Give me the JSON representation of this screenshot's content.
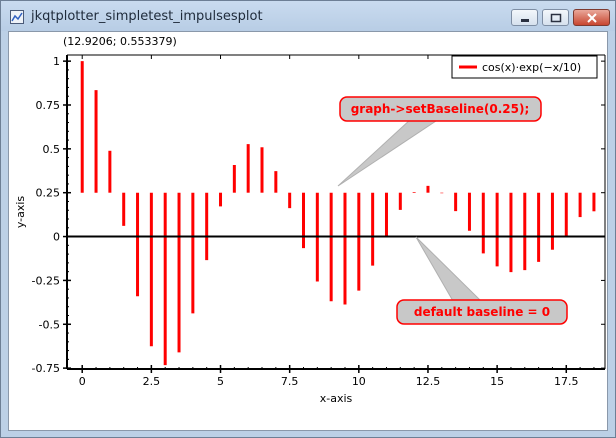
{
  "window": {
    "title": "jkqtplotter_simpletest_impulsesplot",
    "coordinate_readout": "(12.9206; 0.553379)"
  },
  "colors": {
    "impulse": "#ff0000",
    "annotation_fill": "#c8c8c8",
    "annotation_border": "#ff0000",
    "annotation_text": "#ff0000"
  },
  "annotations": {
    "set_baseline": "graph->setBaseline(0.25);",
    "default_baseline": "default baseline = 0"
  },
  "chart_data": {
    "type": "impulses",
    "xlabel": "x-axis",
    "ylabel": "y-axis",
    "xlim": [
      -0.55,
      18.9
    ],
    "ylim": [
      -0.755,
      1.035
    ],
    "xticks": [
      0,
      2.5,
      5,
      7.5,
      10,
      12.5,
      15,
      17.5
    ],
    "xtick_labels": [
      "0",
      "2.5",
      "5",
      "7.5",
      "10",
      "12.5",
      "15",
      "17.5"
    ],
    "yticks": [
      -0.75,
      -0.5,
      -0.25,
      0,
      0.25,
      0.5,
      0.75,
      1
    ],
    "ytick_labels": [
      "-0.75",
      "-0.5",
      "-0.25",
      "0",
      "0.25",
      "0.5",
      "0.75",
      "1"
    ],
    "baseline": 0.25,
    "legend": {
      "position": "top-right",
      "entries": [
        "cos(x)·exp(−x/10)"
      ]
    },
    "series": [
      {
        "name": "cos(x)·exp(−x/10)",
        "x": [
          0,
          0.5,
          1,
          1.5,
          2,
          2.5,
          3,
          3.5,
          4,
          4.5,
          5,
          5.5,
          6,
          6.5,
          7,
          7.5,
          8,
          8.5,
          9,
          9.5,
          10,
          10.5,
          11,
          11.5,
          12,
          12.5,
          13,
          13.5,
          14,
          14.5,
          15,
          15.5,
          16,
          16.5,
          17,
          17.5,
          18,
          18.5
        ],
        "values": [
          1.0,
          0.835,
          0.489,
          0.061,
          -0.34,
          -0.625,
          -0.733,
          -0.66,
          -0.438,
          -0.134,
          0.172,
          0.408,
          0.527,
          0.509,
          0.373,
          0.162,
          -0.066,
          -0.256,
          -0.369,
          -0.387,
          -0.308,
          -0.166,
          0.002,
          0.152,
          0.254,
          0.289,
          0.247,
          0.145,
          0.033,
          -0.096,
          -0.17,
          -0.203,
          -0.191,
          -0.144,
          -0.075,
          0.002,
          0.111,
          0.144
        ]
      }
    ]
  }
}
